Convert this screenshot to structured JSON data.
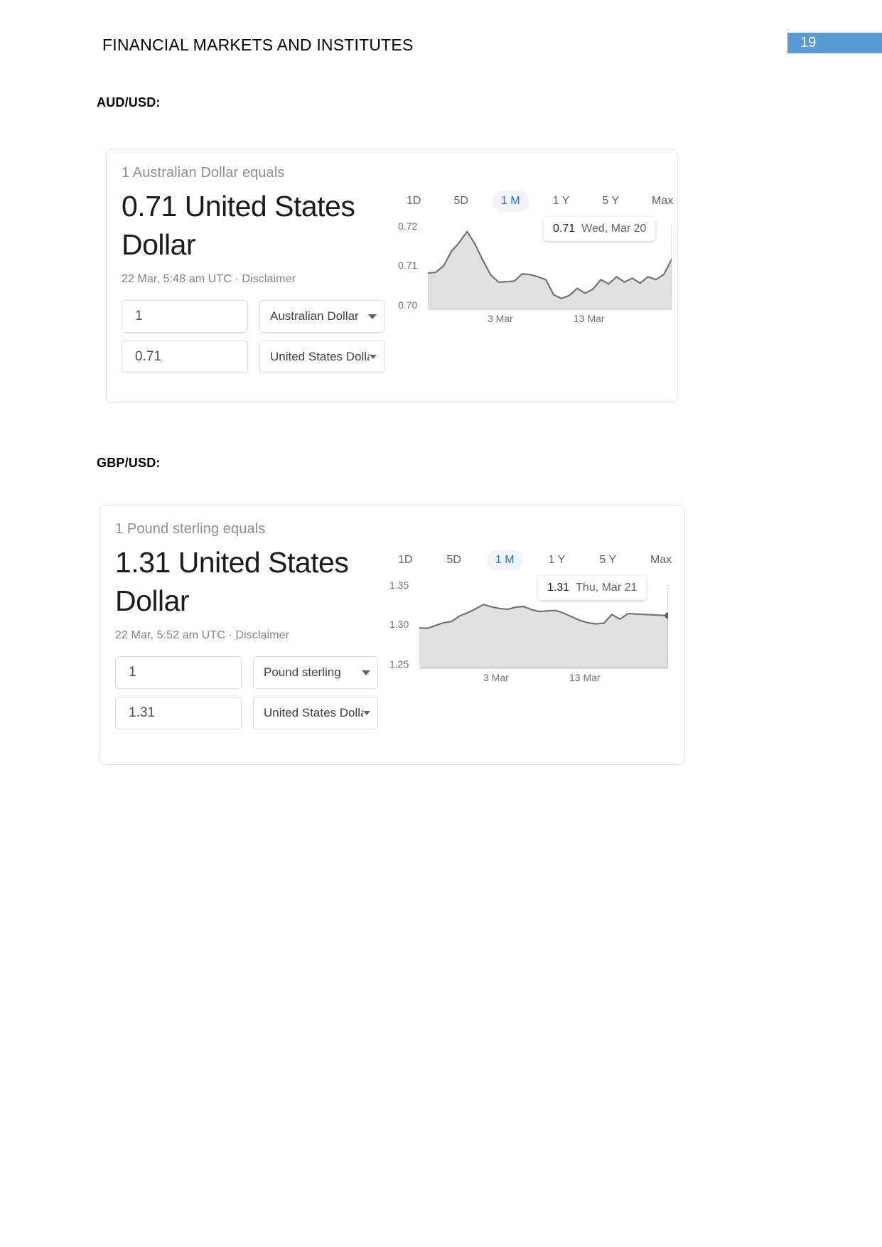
{
  "header": {
    "title": "FINANCIAL MARKETS AND INSTITUTES",
    "page_number": "19",
    "badge_color": "#5b9bd5"
  },
  "sections": [
    {
      "id": "aud",
      "label": "AUD/USD:"
    },
    {
      "id": "gbp",
      "label": "GBP/USD:"
    }
  ],
  "cards": {
    "aud": {
      "equals_line": "1 Australian Dollar equals",
      "rate_headline": "0.71 United States Dollar",
      "timestamp": "22 Mar, 5:48 am UTC · Disclaimer",
      "amount_from": "1",
      "currency_from": "Australian Dollar",
      "amount_to": "0.71",
      "currency_to": "United States Dolla",
      "range_tabs": [
        {
          "label": "1D",
          "active": false
        },
        {
          "label": "5D",
          "active": false
        },
        {
          "label": "1 M",
          "active": true
        },
        {
          "label": "1 Y",
          "active": false
        },
        {
          "label": "5 Y",
          "active": false
        },
        {
          "label": "Max",
          "active": false
        }
      ],
      "tooltip": {
        "value": "0.71",
        "date": "Wed, Mar 20"
      }
    },
    "gbp": {
      "equals_line": "1 Pound sterling equals",
      "rate_headline": "1.31 United States Dollar",
      "timestamp": "22 Mar, 5:52 am UTC · Disclaimer",
      "amount_from": "1",
      "currency_from": "Pound sterling",
      "amount_to": "1.31",
      "currency_to": "United States Dolla",
      "range_tabs": [
        {
          "label": "1D",
          "active": false
        },
        {
          "label": "5D",
          "active": false
        },
        {
          "label": "1 M",
          "active": true
        },
        {
          "label": "1 Y",
          "active": false
        },
        {
          "label": "5 Y",
          "active": false
        },
        {
          "label": "Max",
          "active": false
        }
      ],
      "tooltip": {
        "value": "1.31",
        "date": "Thu, Mar 21"
      }
    }
  },
  "chart_data": [
    {
      "type": "area",
      "id": "aud-usd-1m",
      "title": "AUD/USD 1 Month",
      "xlabel": "",
      "ylabel": "",
      "grid": false,
      "legend": "none",
      "ylim": [
        0.7,
        0.723
      ],
      "yticks": [
        "0.70",
        "0.71",
        "0.72"
      ],
      "ytick_values": [
        0.7,
        0.71,
        0.72
      ],
      "xticks": [
        "3 Mar",
        "13 Mar"
      ],
      "xtick_positions": [
        0.28,
        0.64
      ],
      "annotation": {
        "value": "0.71",
        "date": "Wed, Mar 20"
      },
      "values": [
        0.71,
        0.7102,
        0.712,
        0.716,
        0.7185,
        0.7215,
        0.718,
        0.7135,
        0.7095,
        0.7075,
        0.7076,
        0.7078,
        0.7098,
        0.7096,
        0.709,
        0.7082,
        0.704,
        0.703,
        0.7038,
        0.7058,
        0.7044,
        0.7056,
        0.7082,
        0.707,
        0.709,
        0.7075,
        0.7086,
        0.7072,
        0.709,
        0.7082,
        0.7096,
        0.7138
      ]
    },
    {
      "type": "area",
      "id": "gbp-usd-1m",
      "title": "GBP/USD 1 Month",
      "xlabel": "",
      "ylabel": "",
      "grid": false,
      "legend": "none",
      "ylim": [
        1.25,
        1.355
      ],
      "yticks": [
        "1.25",
        "1.30",
        "1.35"
      ],
      "ytick_values": [
        1.25,
        1.3,
        1.35
      ],
      "xticks": [
        "3 Mar",
        "13 Mar"
      ],
      "xtick_positions": [
        0.3,
        0.67
      ],
      "annotation": {
        "value": "1.31",
        "date": "Thu, Mar 21"
      },
      "values": [
        1.301,
        1.3005,
        1.304,
        1.3075,
        1.309,
        1.316,
        1.32,
        1.325,
        1.3305,
        1.3275,
        1.3255,
        1.3245,
        1.327,
        1.328,
        1.324,
        1.3215,
        1.3225,
        1.323,
        1.3195,
        1.315,
        1.3105,
        1.3075,
        1.306,
        1.307,
        1.318,
        1.312,
        1.319,
        1.3185,
        1.318,
        1.3175,
        1.317,
        1.3165
      ]
    }
  ]
}
